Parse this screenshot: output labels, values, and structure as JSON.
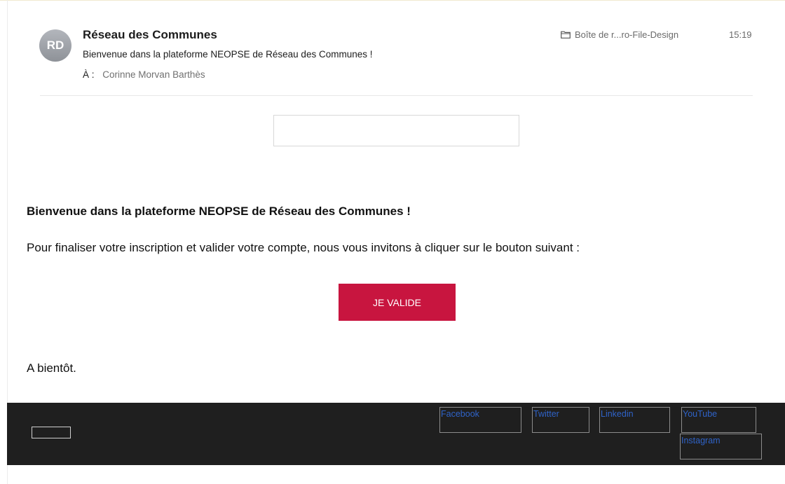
{
  "email": {
    "avatar_initials": "RD",
    "sender": "Réseau des Communes",
    "subject": "Bienvenue dans la plateforme NEOPSE de Réseau des Communes !",
    "to_label": "À :",
    "to_name": "Corinne Morvan Barthès",
    "folder_icon": "folder-icon",
    "folder": "Boîte de r...ro-File-Design",
    "time": "15:19"
  },
  "body": {
    "title": "Bienvenue dans la plateforme NEOPSE de Réseau des Communes !",
    "text": "Pour finaliser votre inscription et valider votre compte, nous vous invitons à cliquer sur le bouton suivant :",
    "button_label": "JE VALIDE",
    "sign_off": "A bientôt."
  },
  "footer": {
    "links": {
      "facebook": "Facebook",
      "twitter": "Twitter",
      "linkedin": "Linkedin",
      "youtube": "YouTube",
      "instagram": "Instagram"
    }
  },
  "colors": {
    "button": "#c8153f",
    "footer_bg": "#1f1f1f",
    "link": "#2f63c8",
    "avatar": "#9ea1a7"
  }
}
